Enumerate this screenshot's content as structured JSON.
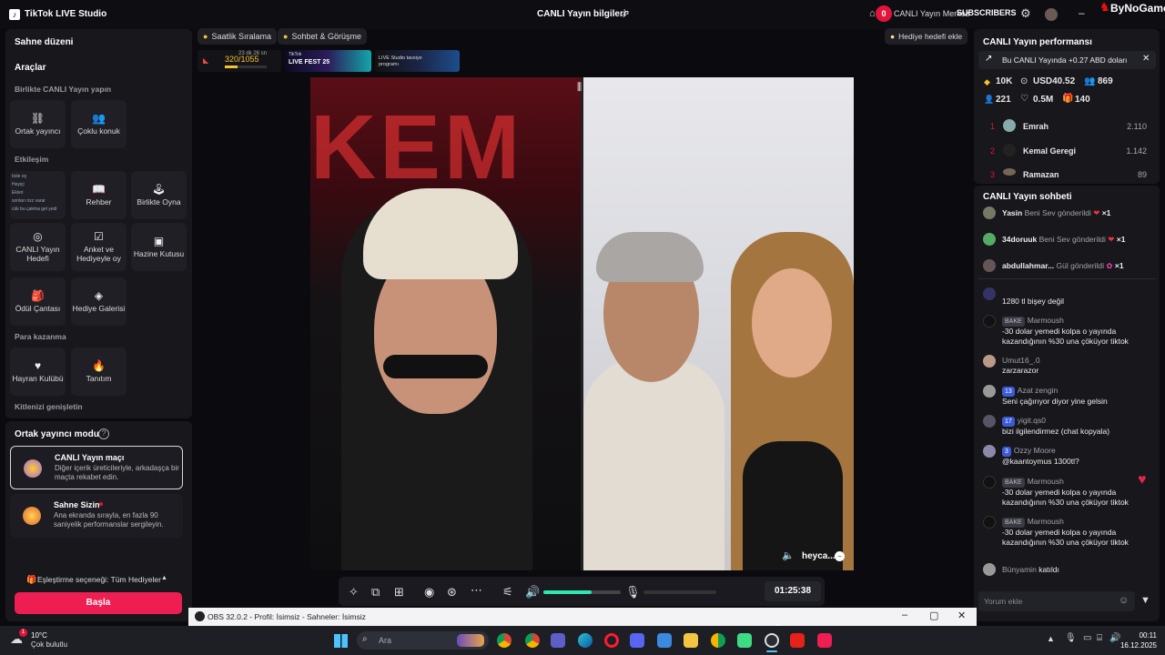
{
  "app": {
    "title": "TikTok LIVE Studio"
  },
  "header": {
    "center_title": "CANLI Yayın bilgileri",
    "right_label": "CANLI Yayın Merkez",
    "notification_count": "0",
    "subscribers_label": "SUBSCRIBERS",
    "watermark": "ByNoGame"
  },
  "left": {
    "scene_title": "Sahne düzeni",
    "tools_title": "Araçlar",
    "together_title": "Birlikte CANLI Yayın yapın",
    "tiles_collab": [
      "Ortak yayıncı",
      "Çoklu konuk"
    ],
    "interaction_title": "Etkileşim",
    "tiles_interaction": [
      "Rehber",
      "Birlikte Oyna",
      "CANLI Yayın Hedefi",
      "Anket ve Hediyeyle oy",
      "Hazine Kutusu",
      "Ödül Çantası",
      "Hediye Galerisi"
    ],
    "monetize_title": "Para kazanma",
    "tiles_monetize": [
      "Hayran Kulübü",
      "Tanıtım"
    ],
    "expand_title": "Kitlenizi genişletin",
    "mini_chat": [
      "bole eş",
      "Heyiçi",
      "Ekleri",
      "sonları rizz varar",
      "cük bu çakma gel yedi"
    ]
  },
  "cohost": {
    "title": "Ortak yayıncı modu",
    "card1_title": "CANLI Yayın maçı",
    "card1_desc": "Diğer içerik üreticileriyle, arkadaşça bir maçta rekabet edin.",
    "card2_title": "Sahne Sizin",
    "card2_desc": "Ana ekranda sırayla, en fazla 90 saniyelik performanslar sergileyin.",
    "match_option": "Eşleştirme seçeneği: Tüm Hediyeler",
    "start_button": "Başla"
  },
  "stage": {
    "chip1": "Saatlik Sıralama",
    "chip2": "Sohbet & Görüşme",
    "goal_button": "Hediye hedefi ekle",
    "rank_text": "320/1055",
    "rank_time": "23 dk 26 sn",
    "banner1": "LIVE FEST 25",
    "banner2": "LIVE Studio tavsiye programı",
    "video_name": "heyca...",
    "timer": "01:25:38",
    "volume_level": 0.62
  },
  "performance": {
    "title": "CANLI Yayın performansı",
    "earning_note": "Bu CANLI Yayında +0.27 ABD doları",
    "stats": [
      "10K",
      "USD40.52",
      "869",
      "221",
      "0.5M",
      "140"
    ],
    "leaderboard": [
      {
        "rank": "1",
        "name": "Emrah",
        "score": "2.110"
      },
      {
        "rank": "2",
        "name": "Kemal Geregi",
        "score": "1.142"
      },
      {
        "rank": "3",
        "name": "Ramazan",
        "score": "89"
      }
    ]
  },
  "chat": {
    "title": "CANLI Yayın sohbeti",
    "gifts": [
      {
        "name": "Yasin",
        "text": "Beni Sev gönderildi",
        "count": "×1"
      },
      {
        "name": "34doruuk",
        "text": "Beni Sev gönderildi",
        "count": "×1"
      },
      {
        "name": "abdullahmar...",
        "text": "Gül gönderildi",
        "count": "×1"
      }
    ],
    "messages": [
      {
        "name": "",
        "badge": "",
        "text": "1280 tl bişey değil"
      },
      {
        "name": "Marmoush",
        "badge": "BAKE",
        "text": "-30 dolar yemedi kolpa o yayında kazandığının %30 una çöküyor tiktok"
      },
      {
        "name": "Umut16_.0",
        "badge": "",
        "text": "zarzarazor"
      },
      {
        "name": "Azat zengin",
        "badge": "13",
        "text": "Seni çağırıyor diyor yine gelsin"
      },
      {
        "name": "yigit.qs0",
        "badge": "17",
        "text": "bizi ilgilendirmez (chat kopyala)"
      },
      {
        "name": "Ozzy Moore",
        "badge": "3",
        "text": "@kaantoymus 1300tl?"
      },
      {
        "name": "Marmoush",
        "badge": "BAKE",
        "text": "-30 dolar yemedi kolpa o yayında kazandığının %30 una çöküyor tiktok"
      },
      {
        "name": "Marmoush",
        "badge": "BAKE",
        "text": "-30 dolar yemedi kolpa o yayında kazandığının %30 una çöküyor tiktok"
      }
    ],
    "join_name": "Bünyamin",
    "join_text": "katıldı",
    "input_placeholder": "Yorum ekle"
  },
  "obs": {
    "title": "OBS 32.0.2 - Profil: İsimsiz - Sahneler: İsimsiz"
  },
  "taskbar": {
    "weather_temp": "10°C",
    "weather_desc": "Çok bulutlu",
    "weather_badge": "1",
    "search_placeholder": "Ara",
    "time": "00:11",
    "date": "16.12.2025"
  }
}
